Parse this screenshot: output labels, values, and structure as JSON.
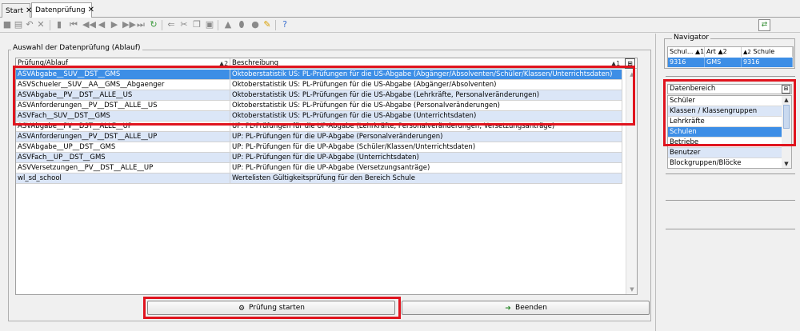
{
  "tabs": [
    {
      "label": "Start",
      "close": "✕"
    },
    {
      "label": "Datenprüfung",
      "close": "✕"
    }
  ],
  "main": {
    "group_title": "Auswahl der Datenprüfung (Ablauf)",
    "columns": [
      {
        "label": "Prüfung/Ablauf",
        "sort": "▲2"
      },
      {
        "label": "Beschreibung",
        "sort": "▲1"
      }
    ],
    "rows": [
      {
        "name": "ASVAbgabe__SUV__DST__GMS",
        "desc": "Oktoberstatistik US: PL-Prüfungen für die US-Abgabe (Abgänger/Absolventen/Schüler/Klassen/Unterrichtsdaten)"
      },
      {
        "name": "ASVSchueler__SUV__AA__GMS__Abgaenger",
        "desc": "Oktoberstatistik US: PL-Prüfungen für die US-Abgabe (Abgänger/Absolventen)"
      },
      {
        "name": "ASVAbgabe__PV__DST__ALLE__US",
        "desc": "Oktoberstatistik US: PL-Prüfungen für die US-Abgabe (Lehrkräfte, Personalveränderungen)"
      },
      {
        "name": "ASVAnforderungen__PV__DST__ALLE__US",
        "desc": "Oktoberstatistik US: PL-Prüfungen für die US-Abgabe (Personalveränderungen)"
      },
      {
        "name": "ASVFach__SUV__DST__GMS",
        "desc": "Oktoberstatistik US: PL-Prüfungen für die US-Abgabe (Unterrichtsdaten)"
      },
      {
        "name": "ASVAbgabe__PV__DST__ALLE__UP",
        "desc": "UP: PL-Prüfungen für die UP-Abgabe (Lehrkräfte, Personalveränderungen, Versetzungsanträge)"
      },
      {
        "name": "ASVAnforderungen__PV__DST__ALLE__UP",
        "desc": "UP: PL-Prüfungen für die UP-Abgabe (Personalveränderungen)"
      },
      {
        "name": "ASVAbgabe__UP__DST__GMS",
        "desc": "UP: PL-Prüfungen für die UP-Abgabe (Schüler/Klassen/Unterrichtsdaten)"
      },
      {
        "name": "ASVFach__UP__DST__GMS",
        "desc": "UP: PL-Prüfungen für die UP-Abgabe (Unterrichtsdaten)"
      },
      {
        "name": "ASVVersetzungen__PV__DST__ALLE__UP",
        "desc": "UP: PL-Prüfungen für die UP-Abgabe (Versetzungsanträge)"
      },
      {
        "name": "wl_sd_school",
        "desc": "Wertelisten Gültigkeitsprüfung für den Bereich Schule"
      }
    ],
    "selected_row": 0,
    "start_button": "Prüfung starten",
    "end_button": "Beenden"
  },
  "navigator": {
    "title": "Navigator",
    "columns": [
      {
        "label": "Schul...",
        "sort": "▲1"
      },
      {
        "label": "Art",
        "sort": "▲2"
      },
      {
        "label": "Schule",
        "sort": ""
      }
    ],
    "row": [
      "9316",
      "GMS",
      "9316"
    ]
  },
  "datenbereich": {
    "title": "Datenbereich",
    "items": [
      "Schüler",
      "Klassen / Klassengruppen",
      "Lehrkräfte",
      "Schulen",
      "Betriebe",
      "Benutzer",
      "Blockgruppen/Blöcke"
    ],
    "selected": 3
  },
  "colors": {
    "selection": "#3d8ee6",
    "alt_row": "#dbe6f7",
    "highlight_box": "#e0141e"
  }
}
